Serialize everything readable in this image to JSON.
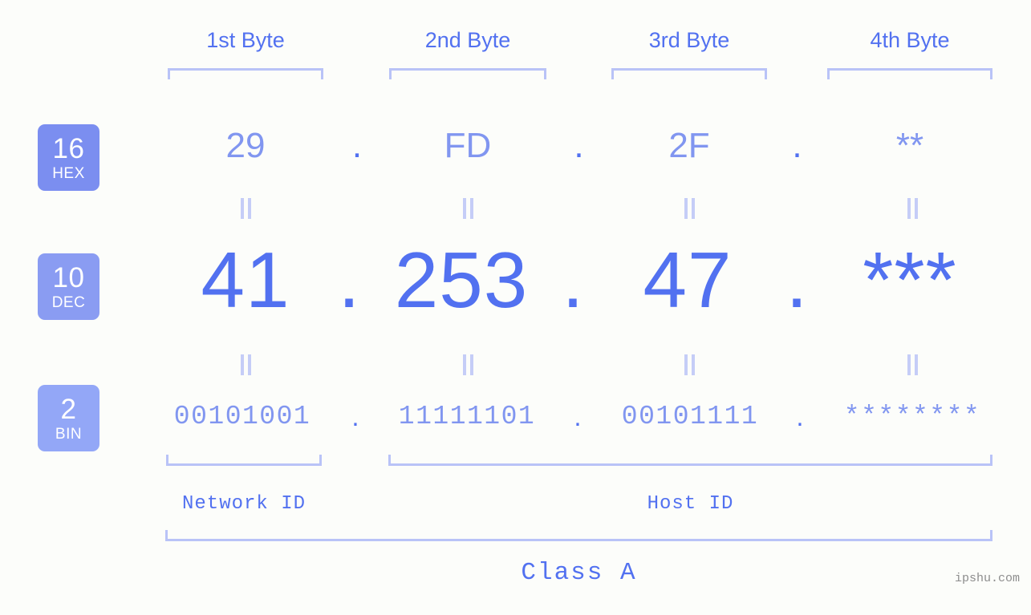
{
  "background": "#fcfdfa",
  "colors": {
    "accent_strong": "#5271f0",
    "accent_light": "#8196f0",
    "bracket": "#b9c3f7",
    "separator": "#c5cdf7",
    "badge_hex": "#7b8ef0",
    "badge_dec": "#8a9cf2",
    "badge_bin": "#93a7f7",
    "watermark": "#8d8d8d"
  },
  "byte_headers": [
    {
      "label": "1st Byte"
    },
    {
      "label": "2nd Byte"
    },
    {
      "label": "3rd Byte"
    },
    {
      "label": "4th Byte"
    }
  ],
  "bases": [
    {
      "number": "16",
      "name": "HEX"
    },
    {
      "number": "10",
      "name": "DEC"
    },
    {
      "number": "2",
      "name": "BIN"
    }
  ],
  "rows": {
    "hex": {
      "base_number": "16",
      "base_name": "HEX",
      "values": [
        "29",
        "FD",
        "2F",
        "**"
      ],
      "separators": [
        ".",
        ".",
        "."
      ]
    },
    "dec": {
      "base_number": "10",
      "base_name": "DEC",
      "values": [
        "41",
        "253",
        "47",
        "***"
      ],
      "separators": [
        ".",
        ".",
        "."
      ]
    },
    "bin": {
      "base_number": "2",
      "base_name": "BIN",
      "values": [
        "00101001",
        "11111101",
        "00101111",
        "********"
      ],
      "separators": [
        ".",
        ".",
        "."
      ]
    }
  },
  "equal_separators": {
    "glyph": "||",
    "count_per_row": 4
  },
  "id_sections": [
    {
      "label": "Network ID"
    },
    {
      "label": "Host ID"
    }
  ],
  "class": {
    "label": "Class A"
  },
  "watermark": {
    "text": "ipshu.com"
  }
}
